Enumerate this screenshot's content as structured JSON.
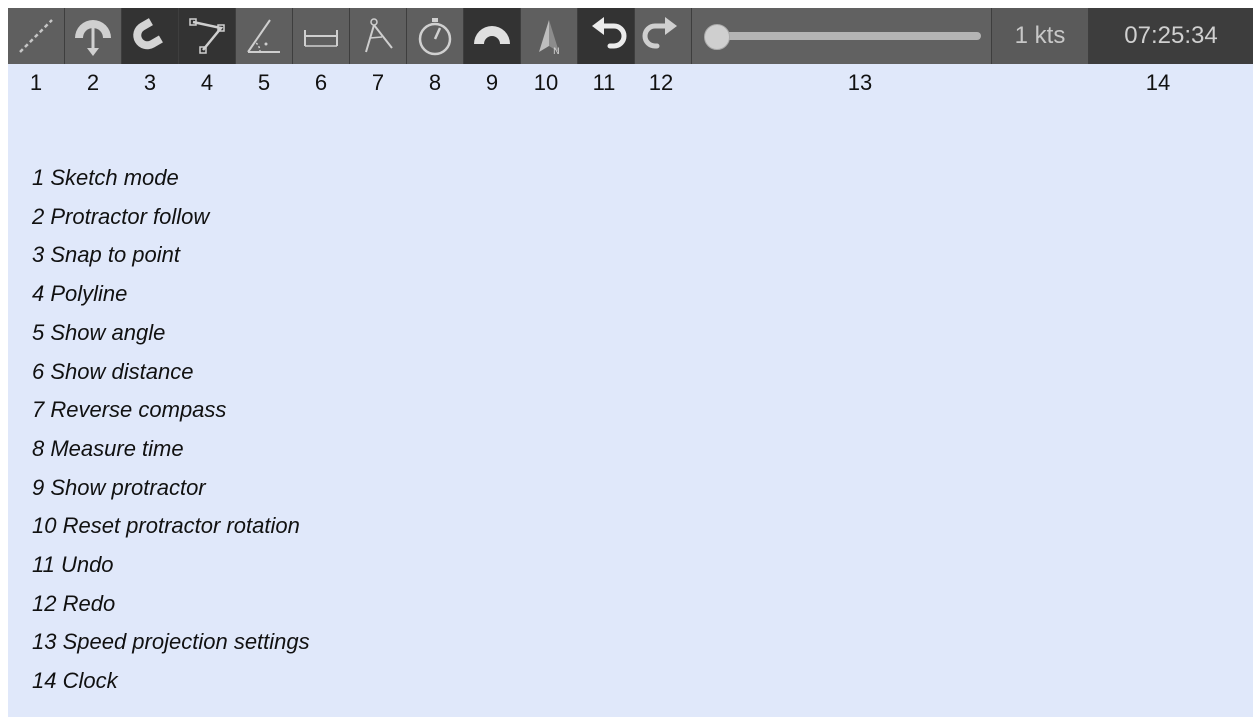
{
  "toolbar": {
    "tools": [
      {
        "number": "1",
        "icon": "dashed-line-icon"
      },
      {
        "number": "2",
        "icon": "protractor-follow-icon"
      },
      {
        "number": "3",
        "icon": "magnet-icon"
      },
      {
        "number": "4",
        "icon": "polyline-icon"
      },
      {
        "number": "5",
        "icon": "angle-icon"
      },
      {
        "number": "6",
        "icon": "distance-icon"
      },
      {
        "number": "7",
        "icon": "compass-icon"
      },
      {
        "number": "8",
        "icon": "stopwatch-icon"
      },
      {
        "number": "9",
        "icon": "protractor-icon"
      },
      {
        "number": "10",
        "icon": "north-arrow-icon"
      },
      {
        "number": "11",
        "icon": "undo-icon"
      },
      {
        "number": "12",
        "icon": "redo-icon"
      }
    ],
    "slider": {
      "number": "13",
      "value_fraction": 0
    },
    "speed": "1 kts",
    "clock": {
      "number": "14",
      "time": "07:25:34"
    }
  },
  "legend": [
    "1 Sketch mode",
    "2 Protractor follow",
    "3 Snap to point",
    "4 Polyline",
    "5 Show angle",
    "6 Show distance",
    "7 Reverse compass",
    "8 Measure time",
    "9 Show protractor",
    "10 Reset protractor rotation",
    "11 Undo",
    "12 Redo",
    "13 Speed projection settings",
    "14 Clock"
  ],
  "colors": {
    "background": "#e0e8fa",
    "toolbar": "#404040",
    "tool_button": "#5f5f5f",
    "tool_button_active": "#333333",
    "icon": "#cfcfcf"
  }
}
